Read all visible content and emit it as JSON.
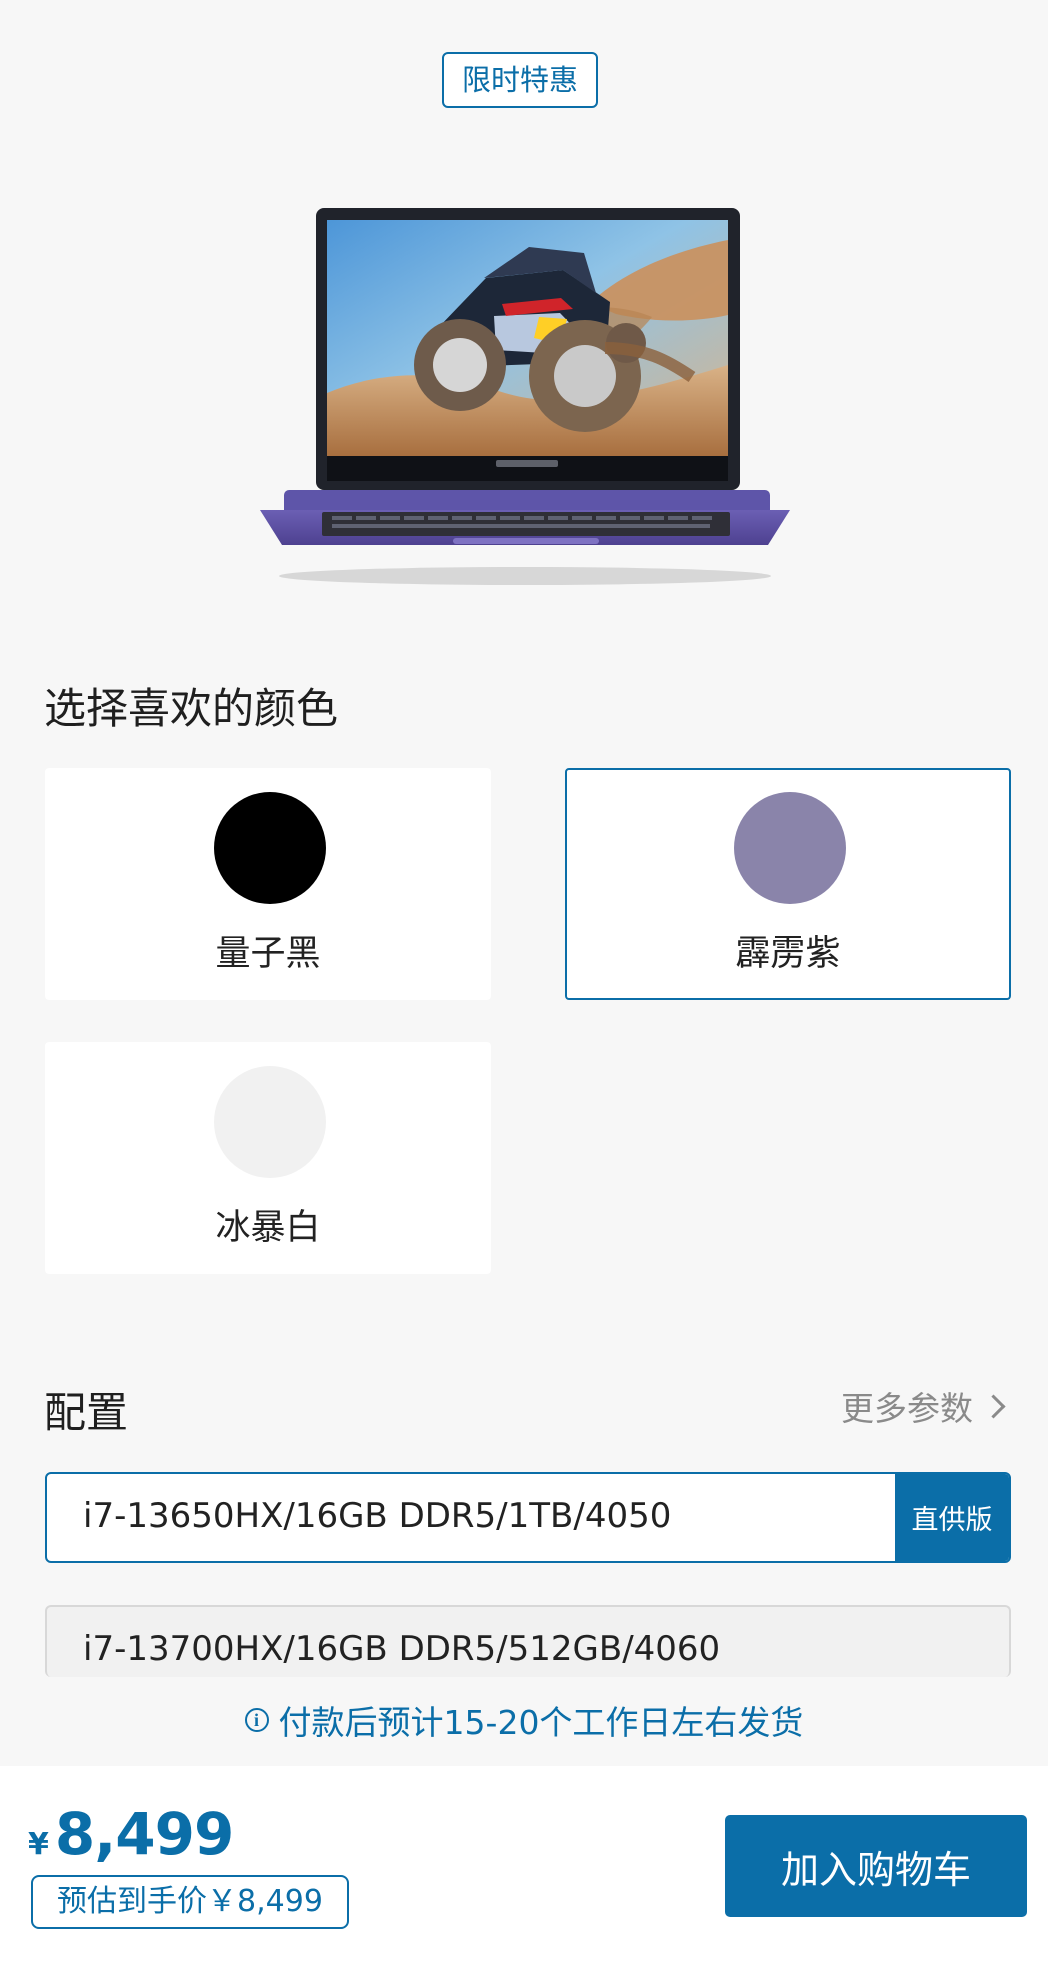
{
  "promo": {
    "label": "限时特惠"
  },
  "product": {
    "image_icon": "laptop-image",
    "colors": {
      "body": "#5B4D9D",
      "keyboard": "#2f2f37",
      "screen_frame": "#20232b"
    }
  },
  "color_section": {
    "title": "选择喜欢的颜色",
    "options": [
      {
        "label": "量子黑",
        "swatch": "#000000",
        "selected": false
      },
      {
        "label": "霹雳紫",
        "swatch": "#8A84AA",
        "selected": true
      },
      {
        "label": "冰暴白",
        "swatch": "#F1F1F1",
        "selected": false
      }
    ]
  },
  "config_section": {
    "title": "配置",
    "more_label": "更多参数",
    "options": [
      {
        "label": "i7-13650HX/16GB DDR5/1TB/4050",
        "badge": "直供版",
        "selected": true
      },
      {
        "label": "i7-13700HX/16GB DDR5/512GB/4060",
        "selected": false
      }
    ]
  },
  "shipping": {
    "text": "付款后预计15-20个工作日左右发货"
  },
  "footer": {
    "currency": "¥",
    "price": "8,499",
    "estimate": "预估到手价￥8,499",
    "add_to_cart": "加入购物车"
  }
}
